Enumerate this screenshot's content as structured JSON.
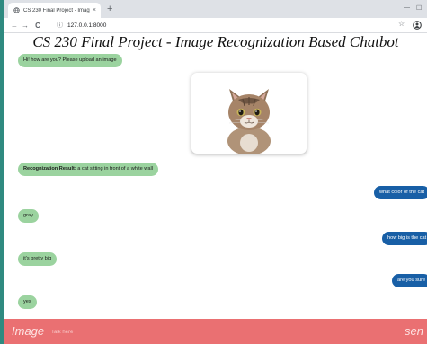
{
  "browser": {
    "tab_title": "CS 230 Final Project - Imag",
    "tab_close": "×",
    "new_tab": "+",
    "url": "127.0.0.1:8000",
    "nav": {
      "back": "←",
      "forward": "→",
      "reload": "C"
    },
    "minimize": "—",
    "maximize": "☐"
  },
  "page": {
    "title": "CS 230 Final Project - Image Recognization Based Chatbot"
  },
  "chat": {
    "greeting": "Hi! how are you? Please upload an image",
    "recognition_label": "Recognization Result:",
    "recognition_text": " a cat sitting in front of a white wall",
    "messages": [
      {
        "from": "user",
        "text": "what color of the cat"
      },
      {
        "from": "bot",
        "text": "gray"
      },
      {
        "from": "user",
        "text": "how big is the cat"
      },
      {
        "from": "bot",
        "text": "it's pretty big"
      },
      {
        "from": "user",
        "text": "are you sure"
      },
      {
        "from": "bot",
        "text": "yes"
      }
    ]
  },
  "footer": {
    "image_button": "Image",
    "input_placeholder": "Talk here",
    "send_button": "sen"
  },
  "colors": {
    "bot_bubble": "#9bd39f",
    "user_bubble": "#185fa6",
    "footer": "#ea7072"
  }
}
